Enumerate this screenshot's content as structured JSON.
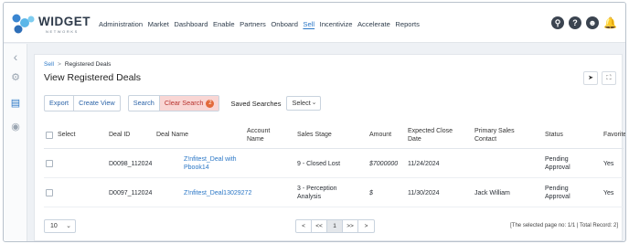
{
  "brand": {
    "name": "WIDGET",
    "tagline": "NETWORKS"
  },
  "nav": {
    "items": [
      "Administration",
      "Market",
      "Dashboard",
      "Enable",
      "Partners",
      "Onboard",
      "Sell",
      "Incentivize",
      "Accelerate",
      "Reports"
    ],
    "active": "Sell"
  },
  "top_icons": [
    "search-icon",
    "help-icon",
    "user-icon",
    "bell-icon"
  ],
  "breadcrumb": {
    "parent": "Sell",
    "current": "Registered Deals"
  },
  "page_title": "View Registered Deals",
  "toolbar": {
    "export_label": "Export",
    "create_view_label": "Create View",
    "search_label": "Search",
    "clear_search_label": "Clear Search",
    "clear_search_count": "2",
    "saved_searches_label": "Saved Searches",
    "saved_searches_value": "Select"
  },
  "table": {
    "headers": {
      "select": "Select",
      "deal_id": "Deal ID",
      "deal_name": "Deal Name",
      "account_name": "Account Name",
      "sales_stage": "Sales Stage",
      "amount": "Amount",
      "expected_close_date": "Expected Close Date",
      "primary_sales_contact": "Primary Sales Contact",
      "status": "Status",
      "favorite": "Favorite"
    },
    "rows": [
      {
        "deal_id": "D0098_112024",
        "deal_name": "Z!nfitest_Deal with Pbook14",
        "account_name": "",
        "sales_stage": "9 - Closed Lost",
        "amount": "$7000000",
        "expected_close_date": "11/24/2024",
        "primary_sales_contact": "",
        "status": "Pending Approval",
        "favorite": "Yes"
      },
      {
        "deal_id": "D0097_112024",
        "deal_name": "Z!nfitest_Deal13029272",
        "account_name": "",
        "sales_stage": "3 - Perception Analysis",
        "amount": "$",
        "expected_close_date": "11/30/2024",
        "primary_sales_contact": "Jack William",
        "status": "Pending Approval",
        "favorite": "Yes"
      }
    ]
  },
  "footer": {
    "page_size": "10",
    "pager": {
      "first": "<",
      "prev": "<<",
      "current": "1",
      "next": ">>",
      "last": ">"
    },
    "page_info": "[The selected page no: 1/1 | Total Record: 2]"
  },
  "colors": {
    "accent": "#2b77c6",
    "clear_bg": "#f9d6d4",
    "badge": "#e2693a"
  }
}
